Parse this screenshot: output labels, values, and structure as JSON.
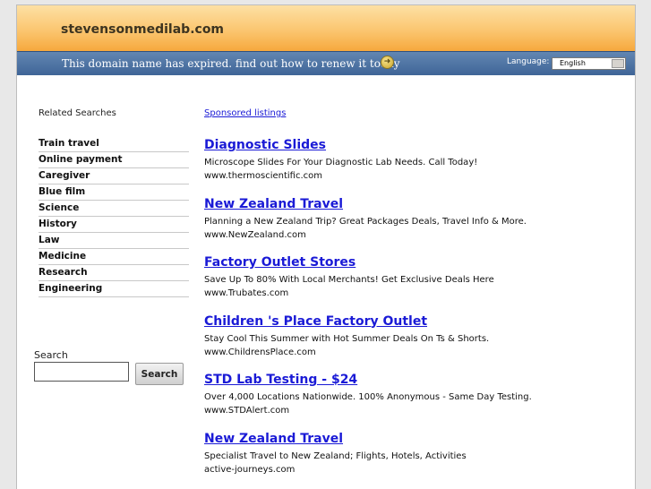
{
  "header": {
    "domain": "stevensonmedilab.com",
    "expired_message": "This domain name has expired. find out how to renew it today",
    "language_label": "Language:",
    "language_value": "English"
  },
  "sidebar": {
    "heading": "Related Searches",
    "items": [
      {
        "label": "Train travel"
      },
      {
        "label": "Online payment"
      },
      {
        "label": "Caregiver"
      },
      {
        "label": "Blue film"
      },
      {
        "label": "Science"
      },
      {
        "label": "History"
      },
      {
        "label": "Law"
      },
      {
        "label": "Medicine"
      },
      {
        "label": "Research"
      },
      {
        "label": "Engineering"
      }
    ],
    "search_label": "Search",
    "search_button": "Search",
    "search_value": ""
  },
  "main": {
    "sponsored_label": "Sponsored listings",
    "listings": [
      {
        "title": "Diagnostic Slides",
        "description": "Microscope Slides For Your Diagnostic Lab Needs. Call Today!",
        "url": "www.thermoscientific.com"
      },
      {
        "title": "New Zealand Travel",
        "description": "Planning a New Zealand Trip? Great Packages Deals, Travel Info & More.",
        "url": "www.NewZealand.com"
      },
      {
        "title": "Factory Outlet Stores",
        "description": "Save Up To 80% With Local Merchants! Get Exclusive Deals Here",
        "url": "www.Trubates.com"
      },
      {
        "title": "Children 's Place Factory Outlet",
        "description": "Stay Cool This Summer with Hot Summer Deals On Ts & Shorts.",
        "url": "www.ChildrensPlace.com"
      },
      {
        "title": "STD Lab Testing - $24",
        "description": "Over 4,000 Locations Nationwide. 100% Anonymous - Same Day Testing.",
        "url": "www.STDAlert.com"
      },
      {
        "title": "New Zealand Travel",
        "description": "Specialist Travel to New Zealand; Flights, Hotels, Activities",
        "url": "active-journeys.com"
      }
    ]
  },
  "colors": {
    "link_blue": "#1a1ad6",
    "header_orange": "#fbc670",
    "header_blue": "#4f75a6"
  },
  "icons": {
    "expired_arrow": "arrow-right-circle-icon"
  }
}
